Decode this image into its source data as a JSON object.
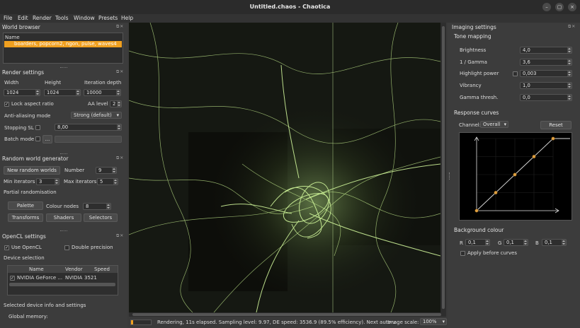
{
  "window": {
    "title": "Untitled.chaos - Chaotica"
  },
  "menu": [
    "File",
    "Edit",
    "Render",
    "Tools",
    "Window",
    "Presets",
    "Help"
  ],
  "world_browser": {
    "title": "World browser",
    "column": "Name",
    "selected_item": "boarders, popcorn2, ngon, pulse, waves4"
  },
  "render_settings": {
    "title": "Render settings",
    "width_label": "Width",
    "height_label": "Height",
    "iter_label": "Iteration depth",
    "width": "1024",
    "height": "1024",
    "iterations": "10000",
    "lock_label": "Lock aspect ratio",
    "aa_level_label": "AA level",
    "aa_level": "2",
    "aa_mode_label": "Anti-aliasing mode",
    "aa_mode": "Strong (default)",
    "stopping_label": "Stopping SL",
    "stopping_value": "8,00",
    "batch_label": "Batch mode",
    "batch_btn": "..."
  },
  "random_world": {
    "title": "Random world generator",
    "new_btn": "New random worlds",
    "number_label": "Number",
    "number": "9",
    "min_label": "Min iterators",
    "min": "3",
    "max_label": "Max iterators",
    "max": "5",
    "partial_label": "Partial randomisation",
    "palette_btn": "Palette",
    "colour_nodes_label": "Colour nodes",
    "colour_nodes": "8",
    "transforms_btn": "Transforms",
    "shaders_btn": "Shaders",
    "selectors_btn": "Selectors"
  },
  "opencl": {
    "title": "OpenCL settings",
    "use_label": "Use OpenCL",
    "double_label": "Double precision",
    "device_label": "Device selection",
    "columns": [
      "Name",
      "Vendor",
      "Speed"
    ],
    "device": {
      "name": "NVIDIA GeForce ...",
      "vendor": "NVIDIA",
      "speed": "3521"
    },
    "selected_info": "Selected device info and settings",
    "global_memory": "Global memory:"
  },
  "imaging": {
    "title": "Imaging settings",
    "tone_mapping": "Tone mapping",
    "brightness_label": "Brightness",
    "brightness": "4,0",
    "gamma_label": "1 / Gamma",
    "gamma": "3,6",
    "highlight_label": "Highlight power",
    "highlight": "0,003",
    "vibrancy_label": "Vibrancy",
    "vibrancy": "1,0",
    "gamma_thresh_label": "Gamma thresh.",
    "gamma_thresh": "0,0",
    "response_curves": "Response curves",
    "channel_label": "Channel:",
    "channel": "Overall",
    "reset_btn": "Reset",
    "curve_points": [
      [
        0,
        0
      ],
      [
        0.25,
        0.25
      ],
      [
        0.5,
        0.5
      ],
      [
        0.75,
        0.75
      ],
      [
        1.0,
        1.0
      ]
    ],
    "background_label": "Background colour",
    "r_label": "R",
    "r": "0,1",
    "g_label": "G",
    "g": "0,1",
    "b_label": "B",
    "b": "0,1",
    "apply_label": "Apply before curves"
  },
  "status": {
    "progress": 0.12,
    "text": "Rendering, 11s elapsed. Sampling level: 9.97, DE speed: 3536.9 (89.5% efficiency). Next auto u",
    "scale_label": "Image scale:",
    "scale": "100%"
  },
  "colors": {
    "accent": "#f0a020",
    "fractal": "#c8f090",
    "curve": "#e0a040"
  }
}
